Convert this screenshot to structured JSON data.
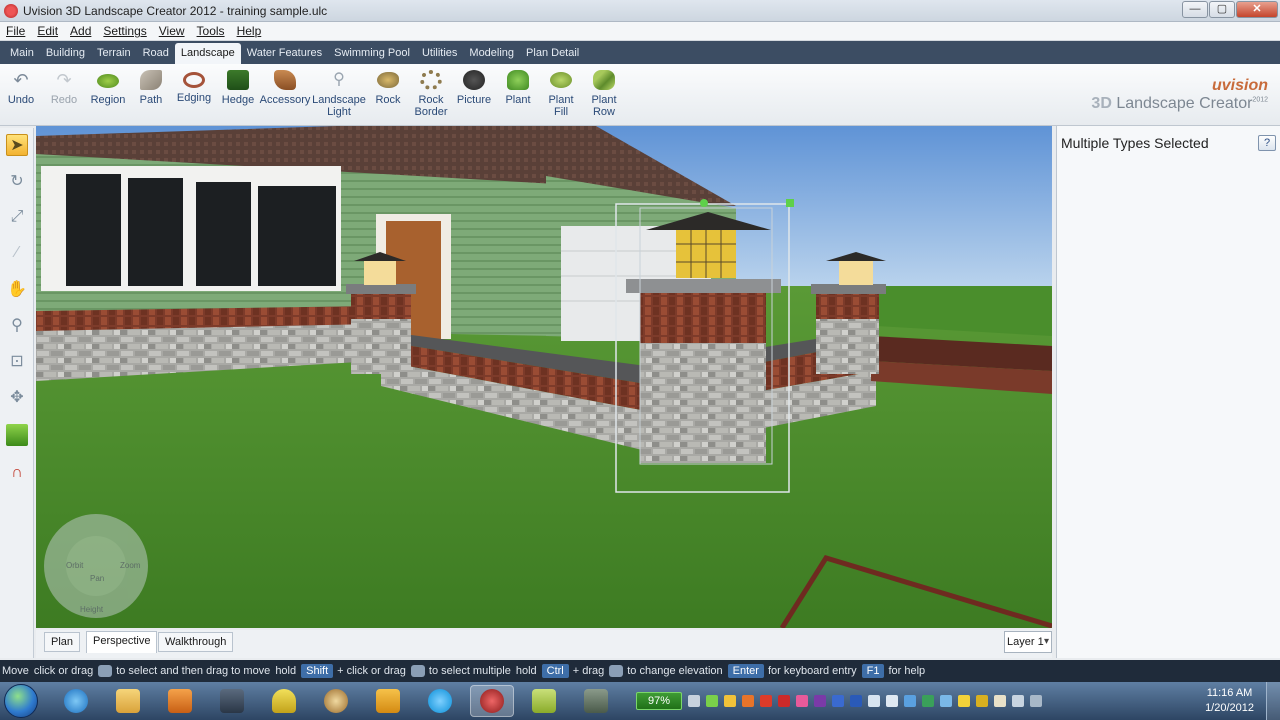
{
  "window": {
    "title": "Uvision 3D Landscape Creator 2012 - training sample.ulc",
    "controls": [
      "minimize",
      "maximize",
      "close"
    ]
  },
  "menu": [
    "File",
    "Edit",
    "Add",
    "Settings",
    "View",
    "Tools",
    "Help"
  ],
  "tabs": [
    {
      "label": "Main"
    },
    {
      "label": "Building"
    },
    {
      "label": "Terrain"
    },
    {
      "label": "Road"
    },
    {
      "label": "Landscape",
      "active": true
    },
    {
      "label": "Water Features"
    },
    {
      "label": "Swimming Pool"
    },
    {
      "label": "Utilities"
    },
    {
      "label": "Modeling"
    },
    {
      "label": "Plan Detail"
    }
  ],
  "tools": [
    {
      "label": "Undo",
      "icon": "undo-icon"
    },
    {
      "label": "Redo",
      "icon": "redo-icon",
      "disabled": true
    },
    {
      "label": "Region",
      "icon": "region-icon"
    },
    {
      "label": "Path",
      "icon": "path-icon"
    },
    {
      "label": "Edging",
      "icon": "edging-icon"
    },
    {
      "label": "Hedge",
      "icon": "hedge-icon"
    },
    {
      "label": "Accessory",
      "icon": "accessory-icon"
    },
    {
      "label": "Landscape Light",
      "icon": "landscape-light-icon"
    },
    {
      "label": "Rock",
      "icon": "rock-icon"
    },
    {
      "label": "Rock Border",
      "icon": "rock-border-icon"
    },
    {
      "label": "Picture",
      "icon": "picture-icon"
    },
    {
      "label": "Plant",
      "icon": "plant-icon"
    },
    {
      "label": "Plant Fill",
      "icon": "plant-fill-icon"
    },
    {
      "label": "Plant Row",
      "icon": "plant-row-icon"
    }
  ],
  "brand": {
    "line1": "uvision",
    "line2": "Landscape Creator",
    "prefix": "3D",
    "year": "2012"
  },
  "left_tools": [
    "select-arrow-icon",
    "orbit-icon",
    "scale-icon",
    "wand-icon",
    "pan-hand-icon",
    "zoom-icon",
    "zoom-extents-icon",
    "navigate-icon",
    "terrain-grid-icon",
    "magnet-icon"
  ],
  "properties_panel": {
    "title": "Multiple Types Selected",
    "help": "?"
  },
  "view_tabs": [
    {
      "label": "Plan"
    },
    {
      "label": "Perspective",
      "active": true
    },
    {
      "label": "Walkthrough"
    }
  ],
  "layer": "Layer 1",
  "compass": {
    "labels": [
      "Orbit",
      "Zoom",
      "Pan",
      "Height"
    ]
  },
  "status": {
    "mode": "Move",
    "t1": "click or drag",
    "t2": "to select and then drag to move",
    "t3": "hold",
    "key1": "Shift",
    "t4": "+ click or drag",
    "t5": "to select multiple",
    "t6": "hold",
    "key2": "Ctrl",
    "t7": "+ drag",
    "t8": "to change elevation",
    "key3": "Enter",
    "t9": "for keyboard entry",
    "key4": "F1",
    "t10": "for help"
  },
  "taskbar": {
    "apps": [
      "internet-explorer-icon",
      "file-explorer-icon",
      "media-player-icon",
      "screen-recorder-icon",
      "keyring-icon",
      "paint-icon",
      "outlook-icon",
      "skype-icon",
      "uvision-icon",
      "notes-icon",
      "tool-icon"
    ],
    "battery": "97%",
    "time": "11:16 AM",
    "date": "1/20/2012"
  },
  "colors": {
    "accent": "#3c4d63",
    "selection": "#ffe27a",
    "grass": "#4b8a2c",
    "siding": "#7aa574",
    "brick": "#8a3d2a"
  }
}
